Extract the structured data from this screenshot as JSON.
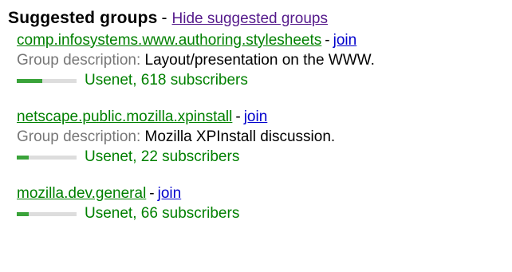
{
  "header": {
    "title": "Suggested groups",
    "separator": "-",
    "hide_link": "Hide suggested groups"
  },
  "colors": {
    "group_link": "#008000",
    "join_link": "#0000cc",
    "hide_link": "#551a8b",
    "description_label": "#777777",
    "activity_fill": "#3aa33a",
    "activity_track": "#dddddd"
  },
  "groups": [
    {
      "name": "comp.infosystems.www.authoring.stylesheets",
      "separator": "-",
      "join_label": "join",
      "description_label": "Group description:",
      "description": "Layout/presentation on the WWW.",
      "meta": "Usenet, 618 subscribers",
      "activity_level": 0.43
    },
    {
      "name": "netscape.public.mozilla.xpinstall",
      "separator": "-",
      "join_label": "join",
      "description_label": "Group description:",
      "description": "Mozilla XPInstall discussion.",
      "meta": "Usenet, 22 subscribers",
      "activity_level": 0.2
    },
    {
      "name": "mozilla.dev.general",
      "separator": "-",
      "join_label": "join",
      "meta": "Usenet, 66 subscribers",
      "activity_level": 0.2
    }
  ]
}
